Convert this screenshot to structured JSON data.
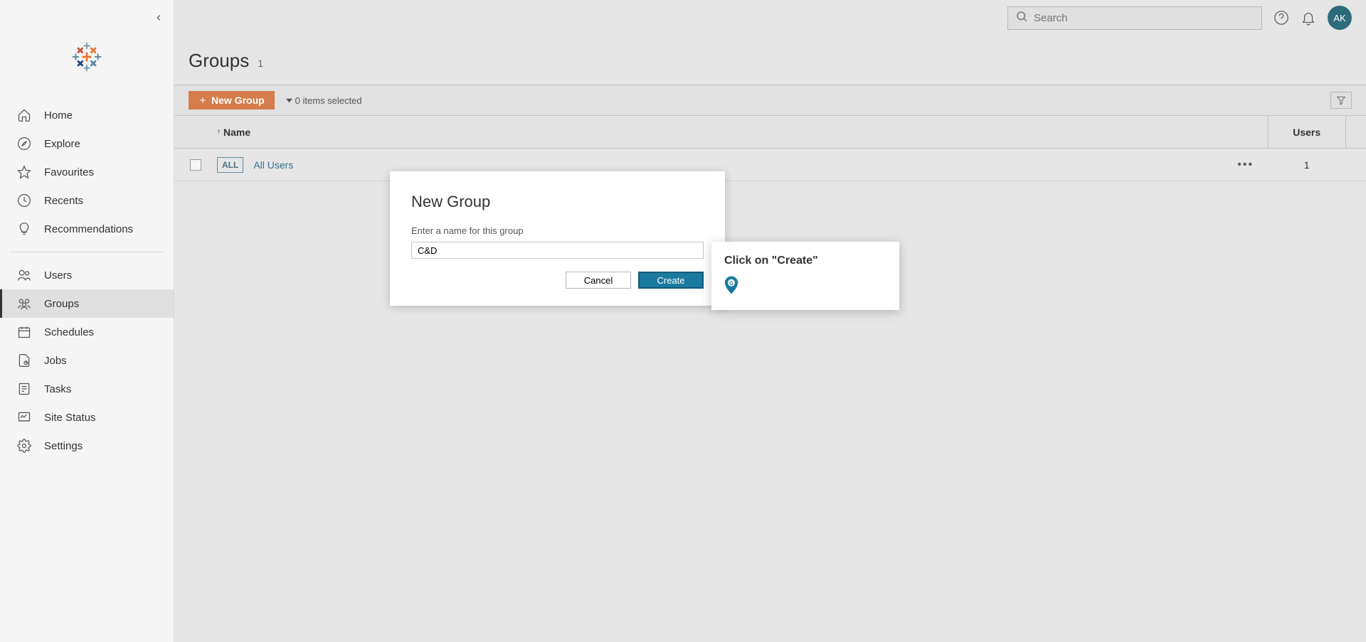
{
  "sidebar": {
    "items": [
      {
        "label": "Home",
        "icon": "home"
      },
      {
        "label": "Explore",
        "icon": "compass"
      },
      {
        "label": "Favourites",
        "icon": "star"
      },
      {
        "label": "Recents",
        "icon": "clock"
      },
      {
        "label": "Recommendations",
        "icon": "bulb"
      }
    ],
    "admin_items": [
      {
        "label": "Users",
        "icon": "users"
      },
      {
        "label": "Groups",
        "icon": "groups"
      },
      {
        "label": "Schedules",
        "icon": "calendar"
      },
      {
        "label": "Jobs",
        "icon": "jobs"
      },
      {
        "label": "Tasks",
        "icon": "tasks"
      },
      {
        "label": "Site Status",
        "icon": "status"
      },
      {
        "label": "Settings",
        "icon": "gear"
      }
    ],
    "active": "Groups"
  },
  "header": {
    "search_placeholder": "Search",
    "avatar_initials": "AK"
  },
  "page": {
    "title": "Groups",
    "count": "1",
    "new_group_label": "New Group",
    "selected_text": "0 items selected",
    "columns": {
      "name": "Name",
      "users": "Users"
    },
    "rows": [
      {
        "badge": "ALL",
        "name": "All Users",
        "users": "1"
      }
    ]
  },
  "modal": {
    "title": "New Group",
    "label": "Enter a name for this group",
    "value": "C&D",
    "cancel": "Cancel",
    "create": "Create"
  },
  "callout": {
    "text": "Click on \"Create\""
  }
}
